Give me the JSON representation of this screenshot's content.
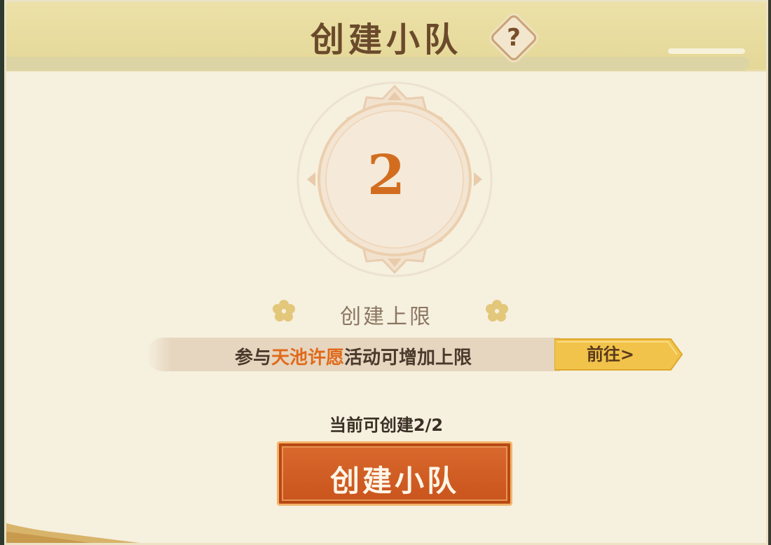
{
  "header": {
    "title": "创建小队",
    "help_icon": "question-icon",
    "help_glyph": "?"
  },
  "emblem": {
    "count": "2"
  },
  "limit": {
    "label": "创建上限"
  },
  "banner": {
    "text_before": "参与",
    "text_highlight": "天池许愿",
    "text_after": "活动可增加上限",
    "goto_label": "前往>"
  },
  "status": {
    "text": "当前可创建2/2"
  },
  "create_button": {
    "label": "创建小队"
  },
  "colors": {
    "accent": "#d26d20",
    "button": "#c9531c",
    "highlight": "#e06a1c",
    "panel": "#f6f0df"
  }
}
